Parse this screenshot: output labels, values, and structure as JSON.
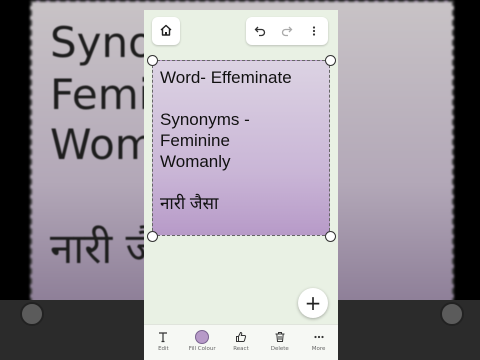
{
  "note": {
    "lines": [
      "Word- Effeminate",
      "Synonyms -",
      "Feminine",
      "Womanly",
      "नारी जैसा"
    ],
    "fill_colour": "#c9b5d6"
  },
  "background": {
    "lines": [
      "Synonyms -",
      "Feminine",
      "Womanly",
      "नारी जैसा"
    ]
  },
  "bottom_toolbar": {
    "edit": "Edit",
    "fill_colour": "Fill Colour",
    "react": "React",
    "delete": "Delete",
    "more": "More"
  },
  "icons": {
    "home": "home-icon",
    "undo": "undo-icon",
    "redo": "redo-icon",
    "menu": "more-vertical-icon",
    "add": "plus-icon"
  },
  "fab": {
    "label": "+"
  }
}
